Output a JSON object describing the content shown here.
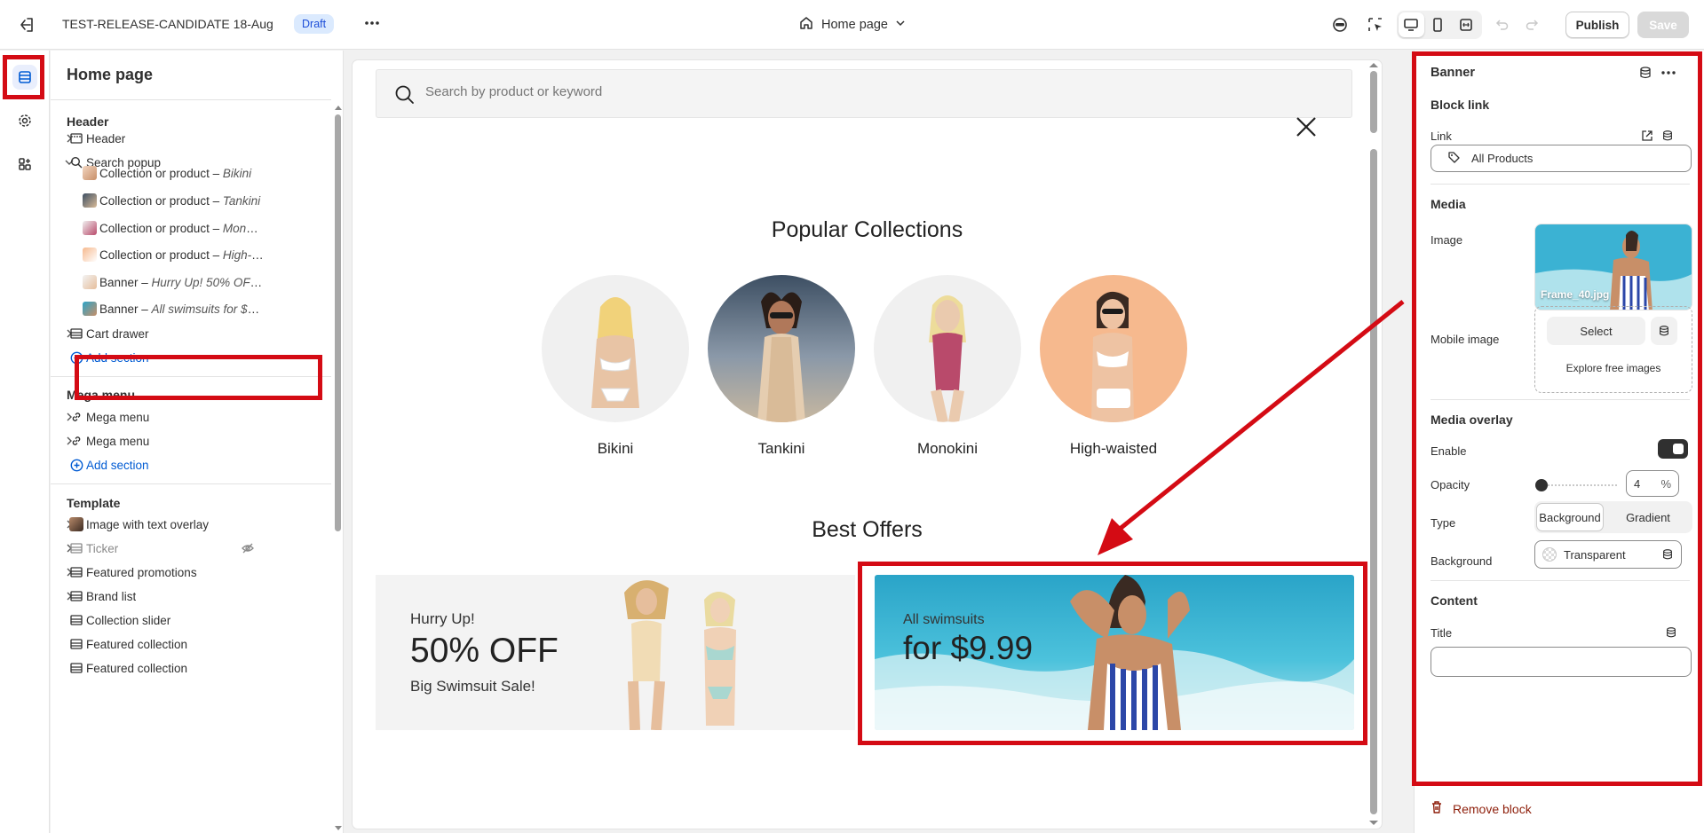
{
  "topbar": {
    "title": "TEST-RELEASE-CANDIDATE 18-Aug",
    "status_badge": "Draft",
    "page_selector": "Home page",
    "publish_label": "Publish",
    "save_label": "Save"
  },
  "left_panel": {
    "title": "Home page",
    "groups": {
      "header": "Header",
      "mega_menu": "Mega menu",
      "template": "Template"
    },
    "header_items": [
      {
        "label": "Header"
      },
      {
        "label": "Search popup"
      },
      {
        "label": "Collection or product",
        "detail": "Bikini"
      },
      {
        "label": "Collection or product",
        "detail": "Tankini"
      },
      {
        "label": "Collection or product",
        "detail": "Monokini"
      },
      {
        "label": "Collection or product",
        "detail": "High-wai..."
      },
      {
        "label": "Banner",
        "detail": "Hurry Up! 50% OFF Big ..."
      },
      {
        "label": "Banner",
        "detail": "All swimsuits for $9.99"
      },
      {
        "label": "Cart drawer"
      },
      {
        "label": "Add section"
      }
    ],
    "separator": " – ",
    "mega_menu_items": [
      {
        "label": "Mega menu"
      },
      {
        "label": "Mega menu"
      },
      {
        "label": "Add section"
      }
    ],
    "template_items": [
      {
        "label": "Image with text overlay"
      },
      {
        "label": "Ticker"
      },
      {
        "label": "Featured promotions"
      },
      {
        "label": "Brand list"
      },
      {
        "label": "Collection slider"
      },
      {
        "label": "Featured collection"
      },
      {
        "label": "Featured collection"
      }
    ]
  },
  "preview": {
    "search_placeholder": "Search by product or keyword",
    "popular_title": "Popular Collections",
    "collections": [
      "Bikini",
      "Tankini",
      "Monokini",
      "High-waisted"
    ],
    "offers_title": "Best Offers",
    "banner1": {
      "kicker": "Hurry Up!",
      "headline": "50% OFF",
      "sub": "Big Swimsuit Sale!"
    },
    "banner2": {
      "kicker": "All swimsuits",
      "headline": "for $9.99"
    }
  },
  "right_panel": {
    "title": "Banner",
    "block_link_heading": "Block link",
    "link_label": "Link",
    "link_value": "All Products",
    "media_heading": "Media",
    "image_label": "Image",
    "image_filename": "Frame_40.jpg",
    "mobile_image_label": "Mobile image",
    "select_label": "Select",
    "explore_label": "Explore free images",
    "overlay_heading": "Media overlay",
    "enable_label": "Enable",
    "enable_on": true,
    "opacity_label": "Opacity",
    "opacity_value": "4",
    "opacity_unit": "%",
    "type_label": "Type",
    "type_options": [
      "Background",
      "Gradient"
    ],
    "type_selected": "Background",
    "background_label": "Background",
    "background_value": "Transparent",
    "content_heading": "Content",
    "title_label": "Title",
    "remove_label": "Remove block"
  },
  "colors": {
    "accent_red": "#d40b14",
    "link_blue": "#005bd3",
    "danger": "#8e1f0b"
  }
}
